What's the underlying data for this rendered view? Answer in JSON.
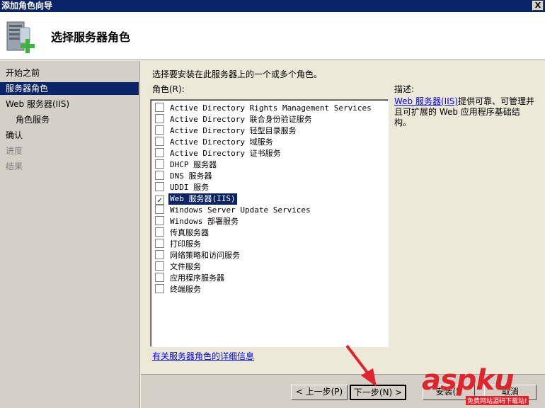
{
  "window": {
    "title": "添加角色向导",
    "close_glyph": "X"
  },
  "header": {
    "title": "选择服务器角色",
    "icon": "server-add-icon"
  },
  "nav": {
    "items": [
      {
        "label": "开始之前"
      },
      {
        "label": "服务器角色"
      },
      {
        "label": "Web 服务器(IIS)"
      },
      {
        "label": "角色服务"
      },
      {
        "label": "确认"
      },
      {
        "label": "进度"
      },
      {
        "label": "结果"
      }
    ]
  },
  "main": {
    "instruction": "选择要安装在此服务器上的一个或多个角色。",
    "roles_label": "角色(R):",
    "description_label": "描述:",
    "roles": [
      {
        "label": "Active Directory Rights Management Services",
        "checked": false
      },
      {
        "label": "Active Directory 联合身份验证服务",
        "checked": false
      },
      {
        "label": "Active Directory 轻型目录服务",
        "checked": false
      },
      {
        "label": "Active Directory 域服务",
        "checked": false
      },
      {
        "label": "Active Directory 证书服务",
        "checked": false
      },
      {
        "label": "DHCP 服务器",
        "checked": false
      },
      {
        "label": "DNS 服务器",
        "checked": false
      },
      {
        "label": "UDDI 服务",
        "checked": false
      },
      {
        "label": "Web 服务器(IIS)",
        "checked": true
      },
      {
        "label": "Windows Server Update Services",
        "checked": false
      },
      {
        "label": "Windows 部署服务",
        "checked": false
      },
      {
        "label": "传真服务器",
        "checked": false
      },
      {
        "label": "打印服务",
        "checked": false
      },
      {
        "label": "网络策略和访问服务",
        "checked": false
      },
      {
        "label": "文件服务",
        "checked": false
      },
      {
        "label": "应用程序服务器",
        "checked": false
      },
      {
        "label": "终端服务",
        "checked": false
      }
    ],
    "description_link": "Web 服务器(IIS)",
    "description_text": "提供可靠、可管理并且可扩展的 Web 应用程序基础结构。",
    "more_info_link": "有关服务器角色的详细信息"
  },
  "footer": {
    "prev_label": "< 上一步(P)",
    "next_label": "下一步(N) >",
    "install_label": "安装(I)",
    "cancel_label": "取消"
  },
  "watermark": {
    "brand": "aspku",
    "tagline": "免费网站源码下载站!"
  },
  "colors": {
    "titlebar": "#0a246a",
    "selection": "#0a246a",
    "arrow": "#e0242c",
    "link": "#0000ff"
  }
}
